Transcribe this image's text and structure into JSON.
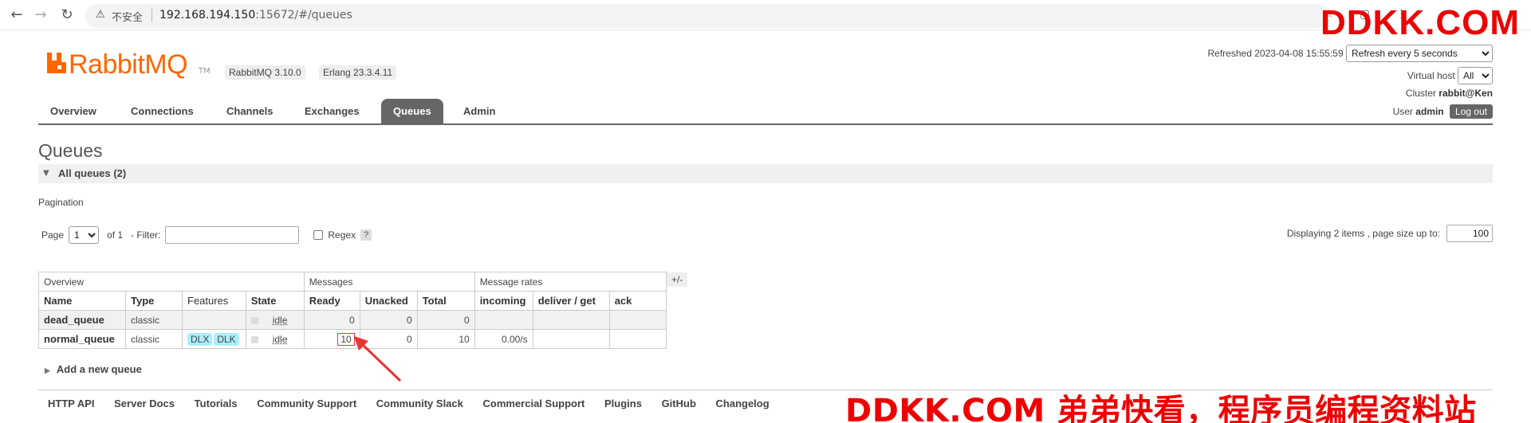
{
  "browser": {
    "insecure_label": "不安全",
    "url_host": "192.168.194.150",
    "url_rest": ":15672/#/queues"
  },
  "brand": {
    "logo_text": "RabbitMQ",
    "tm": "TM",
    "version": "RabbitMQ 3.10.0",
    "erlang": "Erlang 23.3.4.11",
    "color": "#ff6600"
  },
  "status": {
    "refreshed_label": "Refreshed",
    "refreshed_time": "2023-04-08 15:55:59",
    "refresh_option": "Refresh every 5 seconds",
    "vhost_label": "Virtual host",
    "vhost_value": "All",
    "cluster_label": "Cluster",
    "cluster_value": "rabbit@Ken",
    "user_label": "User",
    "user_value": "admin",
    "logout": "Log out"
  },
  "tabs": [
    "Overview",
    "Connections",
    "Channels",
    "Exchanges",
    "Queues",
    "Admin"
  ],
  "active_tab": "Queues",
  "page": {
    "title": "Queues",
    "section": "All queues (2)",
    "pagination_label": "Pagination"
  },
  "pagination": {
    "page_label": "Page",
    "page_value": "1",
    "of_label": "of 1",
    "filter_label": "- Filter:",
    "regex_label": "Regex",
    "help": "?",
    "display_text": "Displaying 2 items , page size up to:",
    "page_size": "100"
  },
  "table": {
    "groups": [
      "Overview",
      "Messages",
      "Message rates"
    ],
    "toggle": "+/-",
    "columns": [
      "Name",
      "Type",
      "Features",
      "State",
      "Ready",
      "Unacked",
      "Total",
      "incoming",
      "deliver / get",
      "ack"
    ],
    "rows": [
      {
        "name": "dead_queue",
        "type": "classic",
        "features": [],
        "state": "idle",
        "ready": "0",
        "unacked": "0",
        "total": "0",
        "incoming": "",
        "deliver": "",
        "ack": ""
      },
      {
        "name": "normal_queue",
        "type": "classic",
        "features": [
          "DLX",
          "DLK"
        ],
        "state": "idle",
        "ready": "10",
        "unacked": "0",
        "total": "10",
        "incoming": "0.00/s",
        "deliver": "",
        "ack": ""
      }
    ]
  },
  "add_queue": "Add a new queue",
  "footer": [
    "HTTP API",
    "Server Docs",
    "Tutorials",
    "Community Support",
    "Community Slack",
    "Commercial Support",
    "Plugins",
    "GitHub",
    "Changelog"
  ],
  "watermark": {
    "top": "DDKK.COM",
    "bottom": "DDKK.COM 弟弟快看，程序员编程资料站",
    "color": "#ee0000"
  }
}
